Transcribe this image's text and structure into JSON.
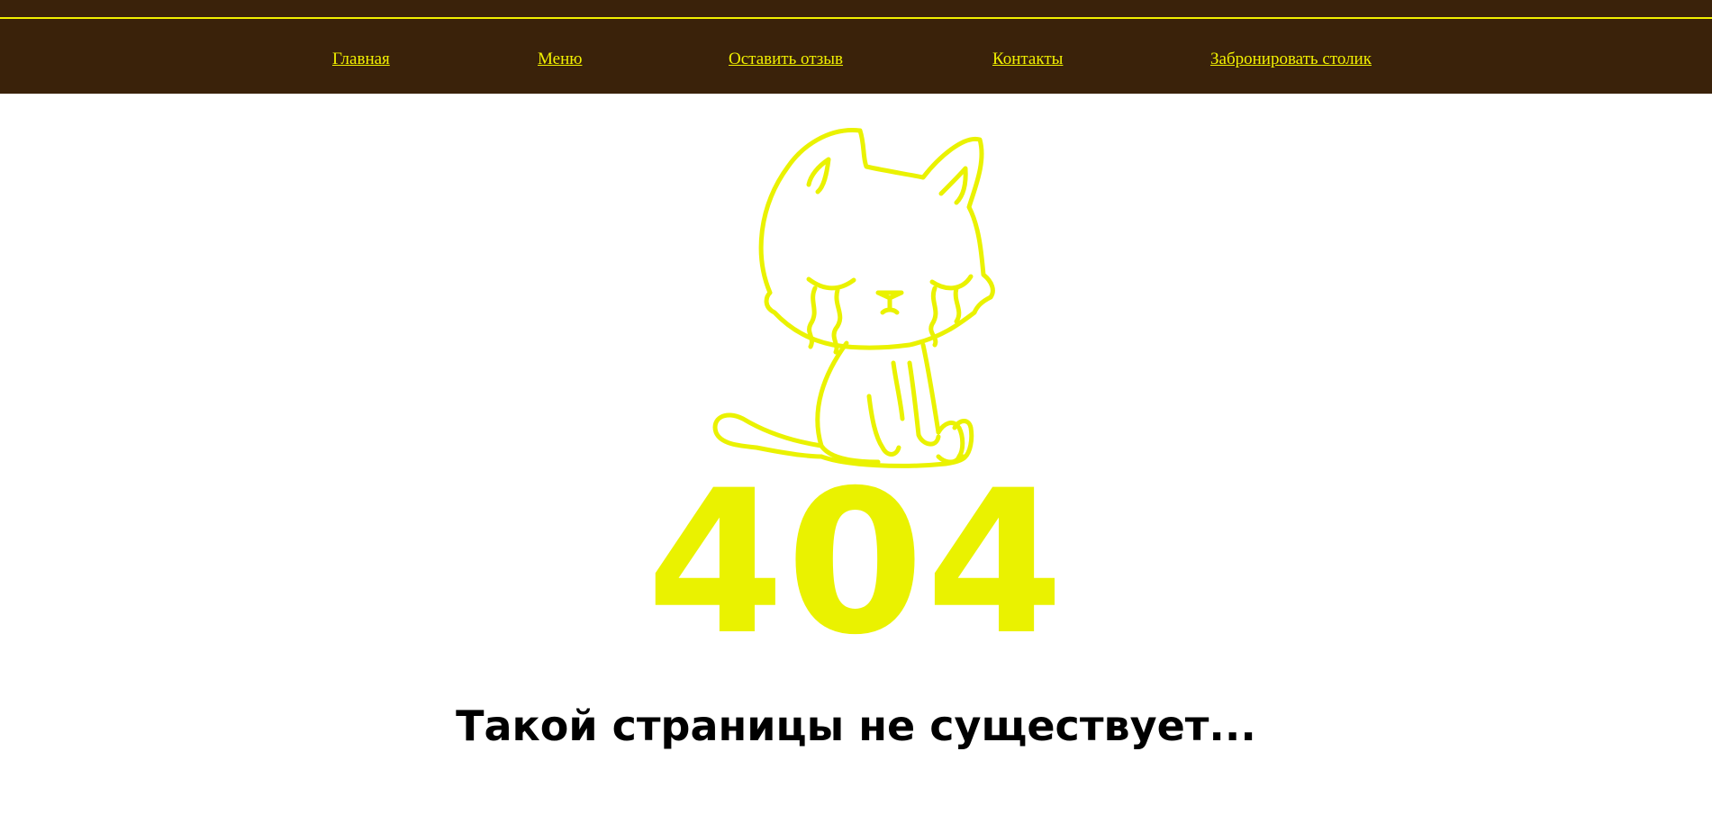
{
  "nav": {
    "items": [
      {
        "label": "Главная"
      },
      {
        "label": "Меню"
      },
      {
        "label": "Оставить отзыв"
      },
      {
        "label": "Контакты"
      },
      {
        "label": "Забронировать столик"
      }
    ]
  },
  "illustration": {
    "icon": "crying-cat-icon",
    "color": "#eaf200"
  },
  "error": {
    "code": "404",
    "message": "Такой страницы не существует..."
  },
  "colors": {
    "header_bg": "#3a220a",
    "accent": "#f1f000",
    "text": "#000000",
    "page_bg": "#ffffff"
  }
}
